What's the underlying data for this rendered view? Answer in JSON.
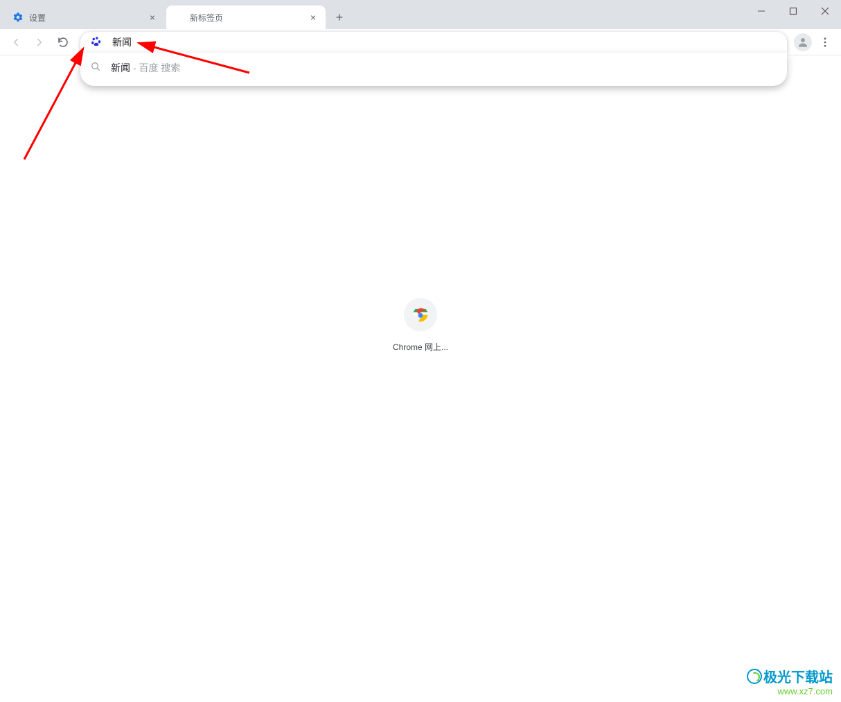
{
  "tabs": [
    {
      "title": "设置",
      "favicon": "gear",
      "active": false
    },
    {
      "title": "新标签页",
      "favicon": "blank",
      "active": true
    }
  ],
  "omnibox": {
    "value": "新闻",
    "search_engine_icon": "baidu-paw"
  },
  "suggestions": [
    {
      "query": "新闻",
      "extra": " - 百度 搜索"
    }
  ],
  "shortcut": {
    "label": "Chrome 网上...",
    "icon": "chrome-store"
  },
  "watermark": {
    "title": "极光下载站",
    "url": "www.xz7.com"
  }
}
